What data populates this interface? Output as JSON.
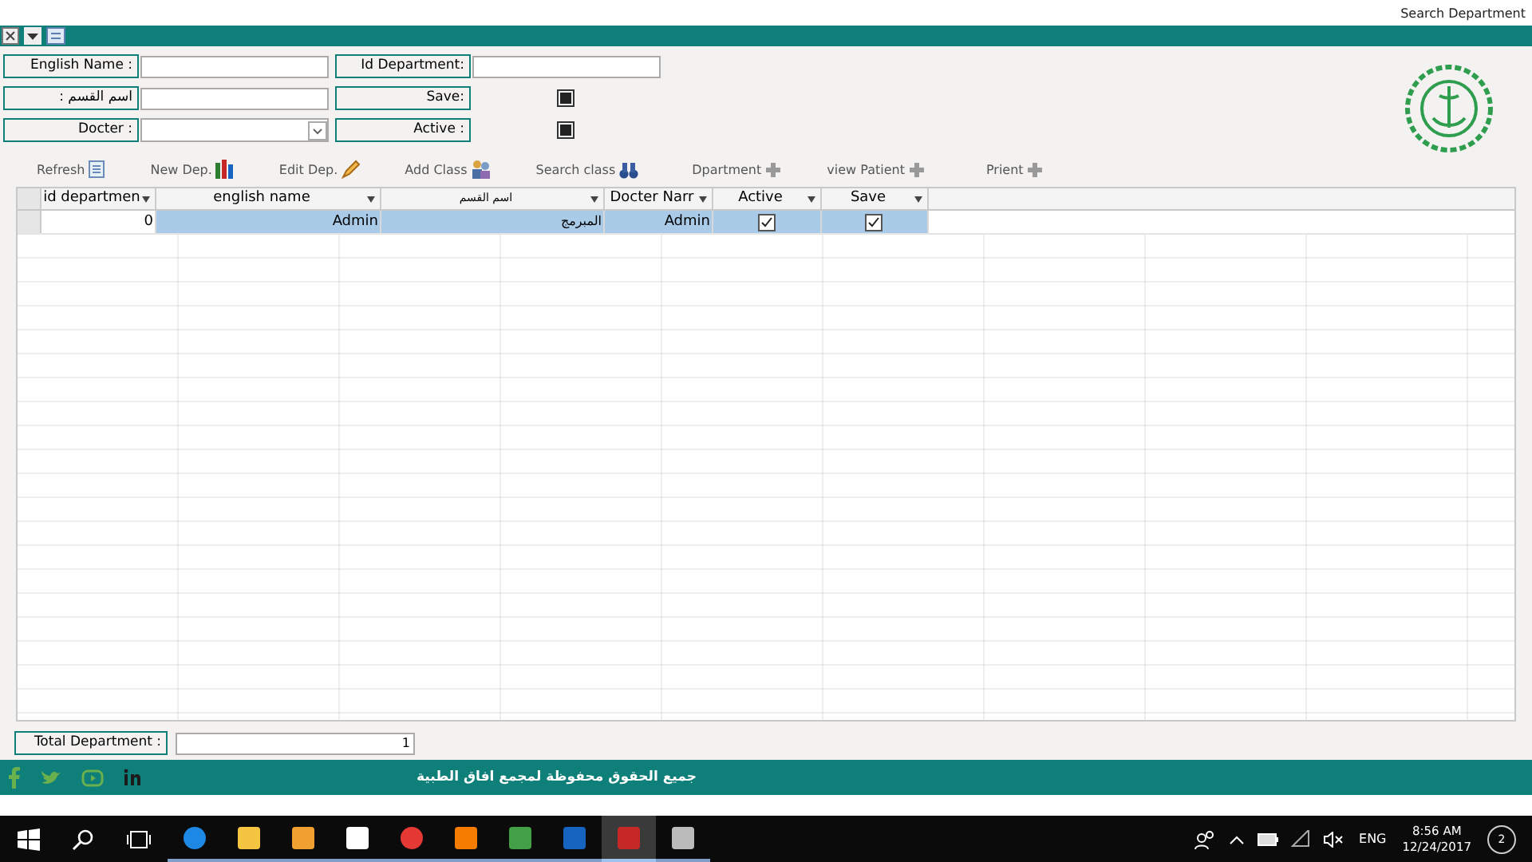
{
  "window": {
    "title": "Search Department"
  },
  "form": {
    "fields": [
      {
        "kind": "text",
        "label": "English Name :"
      },
      {
        "kind": "text",
        "label": "Id Department:"
      },
      {
        "kind": "text",
        "label": ": اسم القسم"
      },
      {
        "kind": "check",
        "label": "Save:",
        "checked": true
      },
      {
        "kind": "combo",
        "label": "Docter :"
      },
      {
        "kind": "check",
        "label": "Active :",
        "checked": true
      }
    ]
  },
  "toolbar": [
    {
      "label": "Refresh"
    },
    {
      "label": "New Dep."
    },
    {
      "label": "Edit Dep."
    },
    {
      "label": "Add Class"
    },
    {
      "label": "Search class"
    },
    {
      "label": "Dpartment"
    },
    {
      "label": "view Patient"
    },
    {
      "label": "Prient"
    }
  ],
  "table": {
    "columns": [
      "id departmen",
      "english name",
      "اسم القسم",
      "Docter Narr",
      "Active",
      "Save"
    ],
    "rows": [
      {
        "selected": true,
        "id": "0",
        "english_name": "Admin",
        "arabic_name": "المبرمج",
        "docter": "Admin",
        "active": true,
        "save": true
      }
    ]
  },
  "total": {
    "label": "Total Department :",
    "value": "1"
  },
  "footer": {
    "text": "جميع الحقوق محفوظة لمجمع افاق الطبية"
  },
  "taskbar": {
    "apps": [
      {
        "active": false
      },
      {
        "active": false
      },
      {
        "active": false
      },
      {
        "active": false
      },
      {
        "active": false
      },
      {
        "active": false
      },
      {
        "active": false
      },
      {
        "active": false
      },
      {
        "active": true
      },
      {
        "active": false
      }
    ],
    "language": "ENG",
    "time": "8:56 AM",
    "date": "12/24/2017",
    "notifications": "2"
  }
}
